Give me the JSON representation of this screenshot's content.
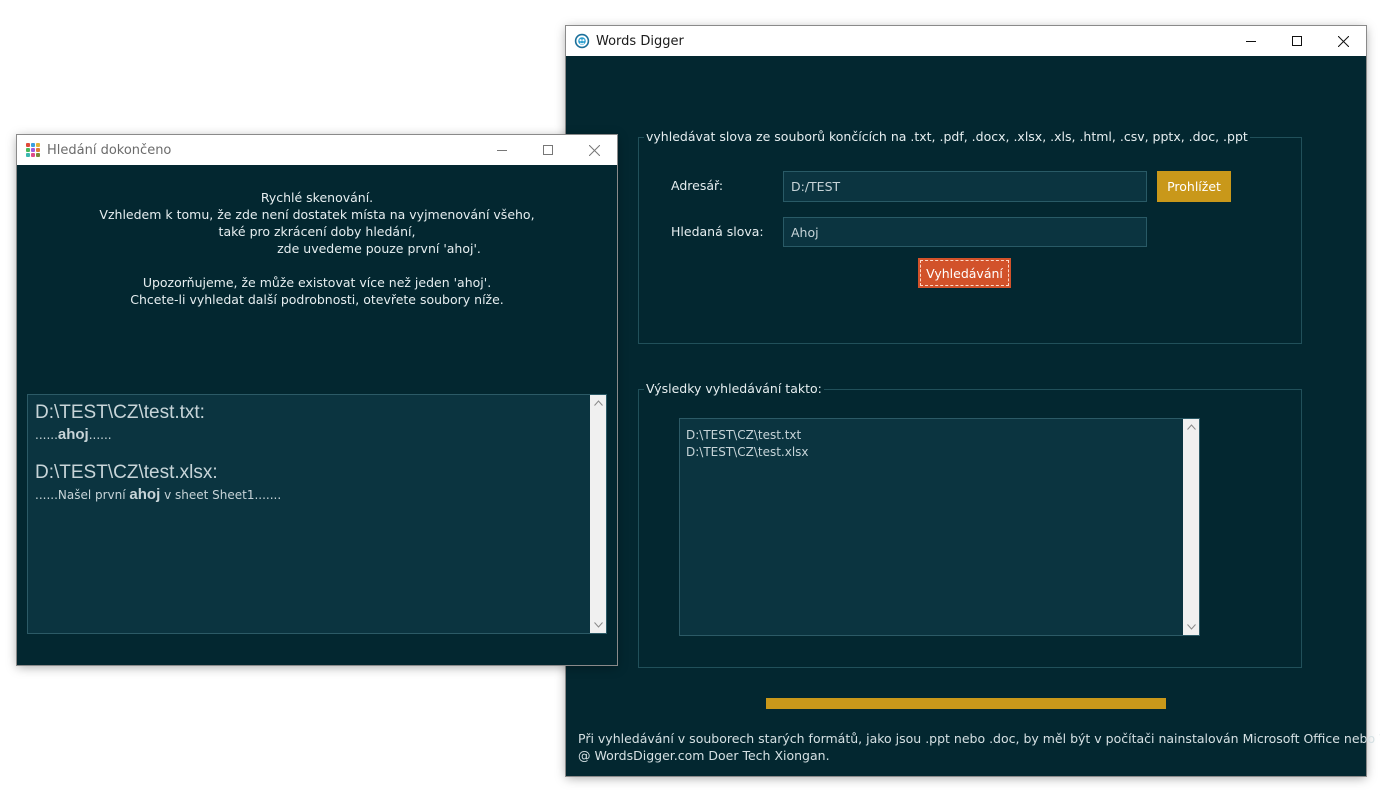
{
  "main_window": {
    "title": "Words Digger",
    "search_group": {
      "label": "vyhledávat slova ze souborů končících na .txt, .pdf, .docx, .xlsx, .xls, .html, .csv, pptx, .doc, .ppt",
      "directory_label": "Adresář:",
      "directory_value": "D:/TEST",
      "browse_label": "Prohlížet",
      "words_label": "Hledaná slova:",
      "words_value": "Ahoj",
      "search_label": "Vyhledávání"
    },
    "results_group": {
      "label": "Výsledky vyhledávání takto:",
      "items": [
        "D:\\TEST\\CZ\\test.txt",
        "D:\\TEST\\CZ\\test.xlsx"
      ]
    },
    "progress": 1.0,
    "footer": {
      "line1": "Při vyhledávání v souborech starých formátů, jako jsou .ppt nebo .doc, by měl být v počítači nainstalován Microsoft Office nebo WPS.",
      "line2": "@ WordsDigger.com Doer Tech Xiongan."
    }
  },
  "dialog": {
    "title": "Hledání dokončeno",
    "message_lines": [
      "Rychlé skenování.",
      "Vzhledem k tomu, že zde není dostatek místa na vyjmenování všeho,",
      "také pro zkrácení doby hledání,",
      "zde uvedeme pouze první 'ahoj'.",
      "",
      "Upozorňujeme, že může existovat více než jeden 'ahoj'.",
      "Chcete-li vyhledat další podrobnosti, otevřete soubory níže."
    ],
    "results": [
      {
        "file": "D:\\TEST\\CZ\\test.txt:",
        "prefix": "......",
        "keyword": "ahoj",
        "suffix": "......"
      },
      {
        "file": "D:\\TEST\\CZ\\test.xlsx:",
        "prefix": "......Našel první ",
        "keyword": "ahoj",
        "suffix": " v sheet Sheet1......."
      }
    ]
  },
  "colors": {
    "background": "#032730",
    "accent_gold": "#c9981a",
    "search_button": "#d2522a",
    "field_bg": "#0b3440"
  }
}
